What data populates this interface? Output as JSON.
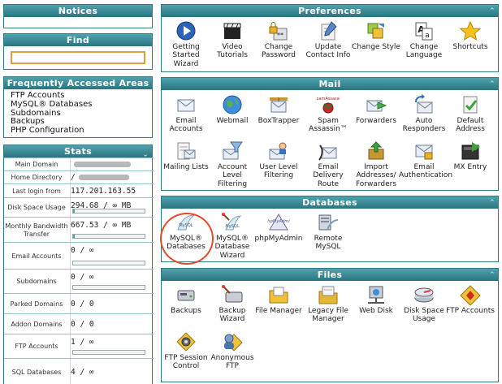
{
  "notices": {
    "title": "Notices"
  },
  "find": {
    "title": "Find"
  },
  "faa": {
    "title": "Frequently Accessed Areas",
    "items": [
      "FTP Accounts",
      "MySQL® Databases",
      "Subdomains",
      "Backups",
      "PHP Configuration"
    ]
  },
  "stats": {
    "title": "Stats",
    "rows": [
      {
        "label": "Main Domain",
        "value": "",
        "hidden": true
      },
      {
        "label": "Home Directory",
        "value": "/",
        "hidden": true
      },
      {
        "label": "Last login from",
        "value": "117.201.163.55"
      },
      {
        "label": "Disk Space Usage",
        "value": "294.68 / ∞ MB",
        "bar": 0.02
      },
      {
        "label": "Monthly Bandwidth Transfer",
        "value": "667.53 / ∞ MB",
        "bar": 0.02
      },
      {
        "label": "Email Accounts",
        "value": "0 / ∞",
        "bar": 0
      },
      {
        "label": "Subdomains",
        "value": "0 / ∞",
        "bar": 0
      },
      {
        "label": "Parked Domains",
        "value": "0 / 0"
      },
      {
        "label": "Addon Domains",
        "value": "0 / 0"
      },
      {
        "label": "FTP Accounts",
        "value": "1 / ∞",
        "bar": 0
      },
      {
        "label": "SQL Databases",
        "value": "4 / ∞"
      }
    ]
  },
  "preferences": {
    "title": "Preferences",
    "items": [
      {
        "label": "Getting Started Wizard",
        "icon": "play-icon"
      },
      {
        "label": "Video Tutorials",
        "icon": "clapboard-icon"
      },
      {
        "label": "Change Password",
        "icon": "password-lock-icon"
      },
      {
        "label": "Update Contact Info",
        "icon": "contact-info-icon"
      },
      {
        "label": "Change Style",
        "icon": "style-icon"
      },
      {
        "label": "Change Language",
        "icon": "language-icon"
      },
      {
        "label": "Shortcuts",
        "icon": "star-icon"
      }
    ]
  },
  "mail": {
    "title": "Mail",
    "items": [
      {
        "label": "Email Accounts",
        "icon": "envelope-icon"
      },
      {
        "label": "Webmail",
        "icon": "globe-icon"
      },
      {
        "label": "BoxTrapper",
        "icon": "boxtrapper-icon"
      },
      {
        "label": "Spam Assassin™",
        "icon": "spamassassin-icon",
        "badge": "SpamAssassin"
      },
      {
        "label": "Forwarders",
        "icon": "forward-mail-icon"
      },
      {
        "label": "Auto Responders",
        "icon": "autoresponder-icon"
      },
      {
        "label": "Default Address",
        "icon": "default-address-icon"
      },
      {
        "label": "Mailing Lists",
        "icon": "mailing-list-icon"
      },
      {
        "label": "Account Level Filtering",
        "icon": "account-filter-icon"
      },
      {
        "label": "User Level Filtering",
        "icon": "user-filter-icon"
      },
      {
        "label": "Email Delivery Route",
        "icon": "delivery-route-icon"
      },
      {
        "label": "Import Addresses/ Forwarders",
        "icon": "import-icon"
      },
      {
        "label": "Email Authentication",
        "icon": "mail-auth-icon"
      },
      {
        "label": "MX Entry",
        "icon": "mx-entry-icon"
      }
    ]
  },
  "databases": {
    "title": "Databases",
    "items": [
      {
        "label": "MySQL® Databases",
        "icon": "mysql-icon",
        "badge": "MySQL"
      },
      {
        "label": "MySQL® Database Wizard",
        "icon": "mysql-wizard-icon",
        "badge": "MySQL"
      },
      {
        "label": "phpMyAdmin",
        "icon": "phpmyadmin-icon",
        "badge": "phpMyAdmin"
      },
      {
        "label": "Remote MySQL",
        "icon": "remote-mysql-icon"
      }
    ]
  },
  "files": {
    "title": "Files",
    "items": [
      {
        "label": "Backups",
        "icon": "backups-icon"
      },
      {
        "label": "Backup Wizard",
        "icon": "backup-wizard-icon"
      },
      {
        "label": "File Manager",
        "icon": "file-manager-icon"
      },
      {
        "label": "Legacy File Manager",
        "icon": "legacy-file-manager-icon"
      },
      {
        "label": "Web Disk",
        "icon": "web-disk-icon"
      },
      {
        "label": "Disk Space Usage",
        "icon": "disk-usage-icon"
      },
      {
        "label": "FTP Accounts",
        "icon": "ftp-accounts-icon"
      },
      {
        "label": "FTP Session Control",
        "icon": "ftp-session-icon"
      },
      {
        "label": "Anonymous FTP",
        "icon": "anonymous-ftp-icon"
      }
    ]
  },
  "toggle_glyph": "⌃"
}
